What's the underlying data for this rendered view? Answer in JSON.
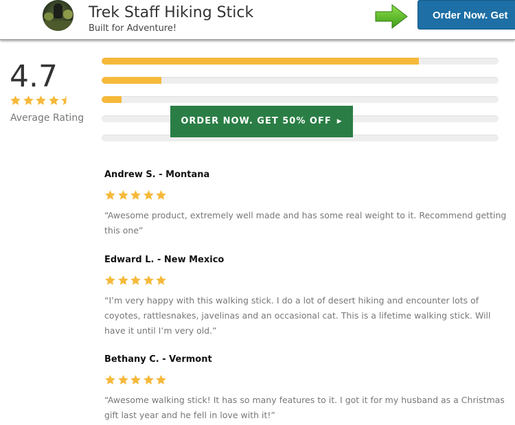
{
  "header": {
    "title": "Trek Staff Hiking Stick",
    "subtitle": "Built for Adventure!",
    "order_button": "Order Now. Get",
    "arrow_icon": "right-arrow-icon",
    "avatar_icon": "hiker-photo"
  },
  "summary": {
    "rating": "4.7",
    "stars": 4.5,
    "label": "Average Rating",
    "distribution": [
      0.8,
      0.15,
      0.05,
      0.0,
      0.0
    ]
  },
  "cta": {
    "label": "ORDER NOW. GET 50% OFF"
  },
  "reviews": [
    {
      "name": "Andrew S. - Montana",
      "stars": 5,
      "text": "“Awesome product, extremely well made and has some real weight to it. Recommend getting this one”"
    },
    {
      "name": "Edward L. - New Mexico",
      "stars": 5,
      "text": "“I’m very happy with this walking stick. I do a lot of desert hiking and encounter lots of coyotes, rattlesnakes, javelinas and an occasional cat. This is a lifetime walking stick. Will have it until I’m very old.”"
    },
    {
      "name": "Bethany C. - Vermont",
      "stars": 5,
      "text": "“Awesome walking stick! It has so many features to it. I got it for my husband as a Christmas gift last year and he fell in love with it!”"
    }
  ],
  "colors": {
    "star": "#f6b93b",
    "bar_fill": "#f6b93b",
    "order_top_bg": "#1d6fa5",
    "order_mid_bg": "#2a7e45"
  }
}
